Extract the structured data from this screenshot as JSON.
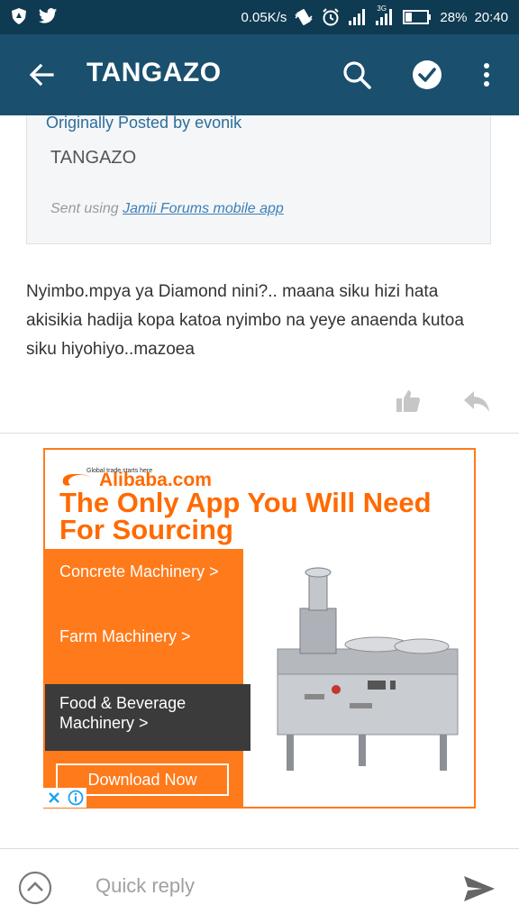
{
  "status_bar": {
    "speed": "0.05K/s",
    "network": "3G",
    "battery": "28%",
    "time": "20:40",
    "icons": [
      "shield-icon",
      "twitter-icon",
      "vibrate-icon",
      "alarm-icon",
      "signal-icon",
      "signal-3g-icon",
      "battery-icon"
    ]
  },
  "app_bar": {
    "title": "TANGAZO",
    "icons": [
      "back-arrow-icon",
      "search-icon",
      "check-circle-icon",
      "more-vert-icon"
    ]
  },
  "quote": {
    "posted_by": "Originally Posted by evonik",
    "text": "TANGAZO",
    "sent_prefix": "Sent using ",
    "sent_link": "Jamii Forums mobile app"
  },
  "post": {
    "body": "Nyimbo.mpya ya Diamond nini?.. maana siku hizi hata akisikia hadija kopa katoa nyimbo na yeye anaenda kutoa siku hiyohiyo..mazoea"
  },
  "post_actions": [
    "thumbs-up-icon",
    "reply-icon"
  ],
  "ad": {
    "brand": "Alibaba.com",
    "tagline": "Global trade starts here",
    "headline": "The Only App You Will Need For Sourcing",
    "items": [
      "Concrete Machinery >",
      "Farm Machinery >",
      "Food & Beverage Machinery >"
    ],
    "button": "Download Now",
    "accent": "#ff7a1a"
  },
  "bottom_bar": {
    "placeholder": "Quick reply",
    "icons": [
      "expand-up-icon",
      "send-icon"
    ]
  },
  "colors": {
    "status_bar": "#0e3a52",
    "app_bar": "#1a4f6e",
    "link": "#2d6e9a"
  }
}
